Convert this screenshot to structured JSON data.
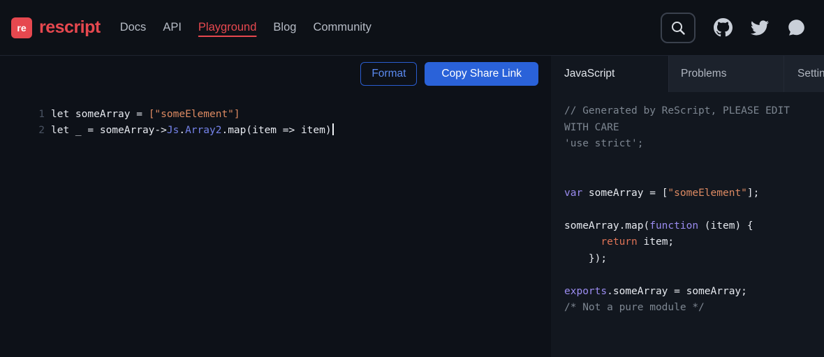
{
  "colors": {
    "brand_red": "#e6484f",
    "button_blue": "#2a62d9",
    "string_orange": "#dd8a62",
    "keyword_purple": "#9b8cf0",
    "module_blue": "#7583ea",
    "comment_gray": "#7d8691",
    "editor_bg": "#0d1118",
    "output_bg": "#12171f"
  },
  "navbar": {
    "logo_text": "re",
    "brand": "rescript",
    "items": [
      {
        "label": "Docs",
        "active": false
      },
      {
        "label": "API",
        "active": false
      },
      {
        "label": "Playground",
        "active": true
      },
      {
        "label": "Blog",
        "active": false
      },
      {
        "label": "Community",
        "active": false
      }
    ],
    "icons": [
      "search",
      "github",
      "twitter",
      "discourse"
    ]
  },
  "editor": {
    "toolbar": {
      "format": "Format",
      "copy_share_link": "Copy Share Link"
    },
    "lines": [
      {
        "num": "1",
        "tokens": [
          {
            "t": "let someArray = ",
            "c": "p"
          },
          {
            "t": "[\"someElement\"]",
            "c": "s"
          }
        ]
      },
      {
        "num": "2",
        "cursor": true,
        "tokens": [
          {
            "t": "let _ = someArray",
            "c": "p"
          },
          {
            "t": "->",
            "c": "p"
          },
          {
            "t": "Js",
            "c": "m"
          },
          {
            "t": ".",
            "c": "p"
          },
          {
            "t": "Array2",
            "c": "m"
          },
          {
            "t": ".map(item => item)",
            "c": "p"
          }
        ]
      }
    ]
  },
  "output": {
    "tabs": [
      {
        "label": "JavaScript",
        "active": true
      },
      {
        "label": "Problems",
        "active": false
      },
      {
        "label": "Settings",
        "active": false
      }
    ],
    "lines": [
      {
        "tokens": [
          {
            "t": "// Generated by ReScript, PLEASE EDIT WITH CARE",
            "c": "c"
          }
        ]
      },
      {
        "tokens": [
          {
            "t": "'use strict';",
            "c": "c"
          }
        ]
      },
      {
        "tokens": []
      },
      {
        "tokens": []
      },
      {
        "tokens": [
          {
            "t": "var",
            "c": "k"
          },
          {
            "t": " someArray = [",
            "c": "p"
          },
          {
            "t": "\"someElement\"",
            "c": "s"
          },
          {
            "t": "];",
            "c": "p"
          }
        ]
      },
      {
        "tokens": []
      },
      {
        "tokens": [
          {
            "t": "someArray.map(",
            "c": "p"
          },
          {
            "t": "function",
            "c": "k"
          },
          {
            "t": " (item) {",
            "c": "p"
          }
        ]
      },
      {
        "tokens": [
          {
            "t": "      ",
            "c": "p"
          },
          {
            "t": "return",
            "c": "r"
          },
          {
            "t": " item;",
            "c": "p"
          }
        ]
      },
      {
        "tokens": [
          {
            "t": "    });",
            "c": "p"
          }
        ]
      },
      {
        "tokens": []
      },
      {
        "tokens": [
          {
            "t": "exports",
            "c": "k"
          },
          {
            "t": ".someArray = someArray;",
            "c": "p"
          }
        ]
      },
      {
        "tokens": [
          {
            "t": "/* Not a pure module */",
            "c": "c"
          }
        ]
      }
    ]
  }
}
